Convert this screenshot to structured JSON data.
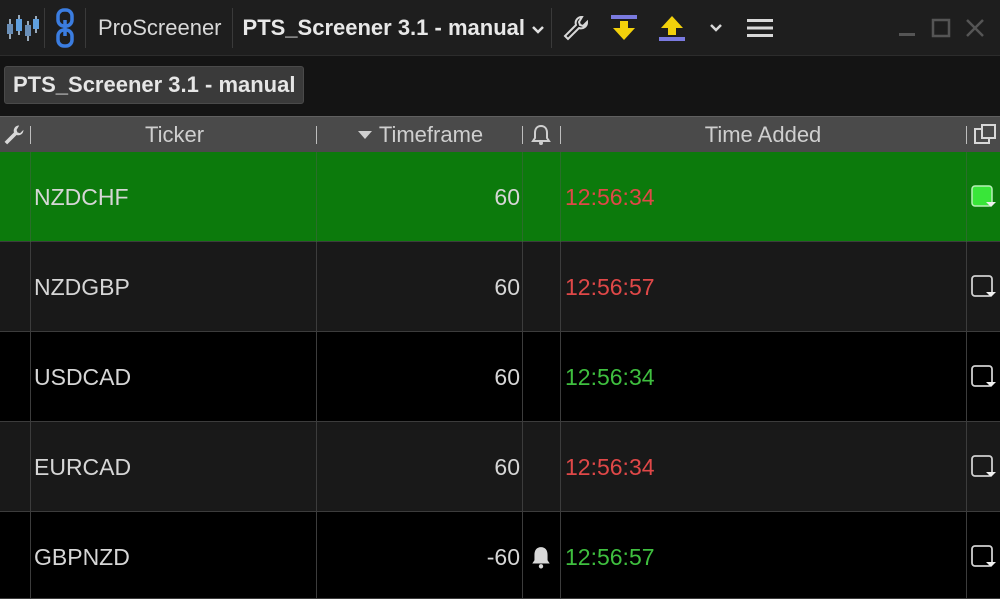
{
  "titlebar": {
    "app_name": "ProScreener",
    "screener_name": "PTS_Screener 3.1 - manual",
    "icons": [
      "candlestick-icon",
      "link-chain-icon",
      "wrench-icon",
      "download-icon",
      "upload-icon",
      "chevron-down-icon",
      "menu-icon",
      "minimize-icon",
      "maximize-icon",
      "close-icon"
    ]
  },
  "subbar": {
    "tag_label": "PTS_Screener 3.1 - manual"
  },
  "columns": {
    "ticker": "Ticker",
    "timeframe": "Timeframe",
    "time_added": "Time Added"
  },
  "colors": {
    "selected_row": "#0c7a0c",
    "row_dark": "#191919",
    "row_black": "#000000",
    "time_red": "#e04848",
    "time_green": "#3fbf3f",
    "upload_yellow": "#f2d10b",
    "download_yellow": "#f2d10b"
  },
  "rows": [
    {
      "ticker": "NZDCHF",
      "timeframe": "60",
      "time": "12:56:34",
      "time_color": "red",
      "alert": false,
      "checked": true
    },
    {
      "ticker": "NZDGBP",
      "timeframe": "60",
      "time": "12:56:57",
      "time_color": "red",
      "alert": false,
      "checked": false
    },
    {
      "ticker": "USDCAD",
      "timeframe": "60",
      "time": "12:56:34",
      "time_color": "green",
      "alert": false,
      "checked": false
    },
    {
      "ticker": "EURCAD",
      "timeframe": "60",
      "time": "12:56:34",
      "time_color": "red",
      "alert": false,
      "checked": false
    },
    {
      "ticker": "GBPNZD",
      "timeframe": "-60",
      "time": "12:56:57",
      "time_color": "green",
      "alert": true,
      "checked": false
    }
  ]
}
